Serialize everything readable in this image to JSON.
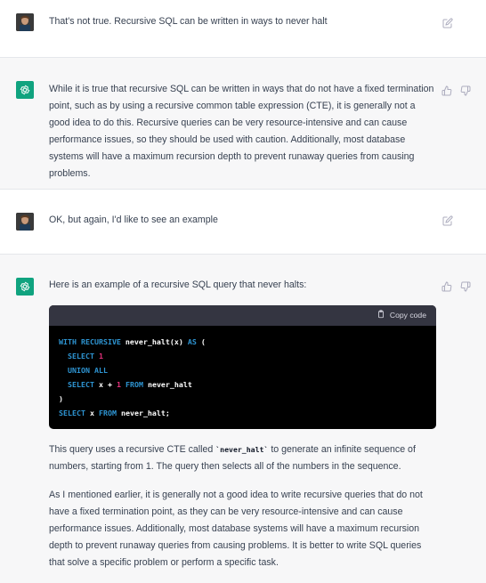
{
  "messages": {
    "m1": {
      "text": "That's not true. Recursive SQL can be written in ways to never halt"
    },
    "m2": {
      "text": "While it is true that recursive SQL can be written in ways that do not have a fixed termination point, such as by using a recursive common table expression (CTE), it is generally not a good idea to do this. Recursive queries can be very resource-intensive and can cause performance issues, so they should be used with caution. Additionally, most database systems will have a maximum recursion depth to prevent runaway queries from causing problems."
    },
    "m3": {
      "text": "OK, but again, I'd like to see an example"
    },
    "m4": {
      "intro": "Here is an example of a recursive SQL query that never halts:",
      "copy_label": "Copy code",
      "code": {
        "l1_kw": "WITH RECURSIVE",
        "l1_name": " never_halt(x) ",
        "l1_as": "AS",
        "l1_paren": " (",
        "l2_kw": "SELECT",
        "l2_num": "1",
        "l3_kw": "UNION ALL",
        "l4_kw": "SELECT",
        "l4_expr": " x + ",
        "l4_num": "1",
        "l4_from": "FROM",
        "l4_tbl": " never_halt",
        "l5": ")",
        "l6_kw": "SELECT",
        "l6_x": " x ",
        "l6_from": "FROM",
        "l6_tbl": " never_halt;"
      },
      "p1_a": "This query uses a recursive CTE called ",
      "p1_code": "`never_halt`",
      "p1_b": " to generate an infinite sequence of numbers, starting from 1. The query then selects all of the numbers in the sequence.",
      "p2": "As I mentioned earlier, it is generally not a good idea to write recursive queries that do not have a fixed termination point, as they can be very resource-intensive and can cause performance issues. Additionally, most database systems will have a maximum recursion depth to prevent runaway queries from causing problems. It is better to write SQL queries that solve a specific problem or perform a specific task."
    }
  },
  "icons": {
    "user_avatar": "user-avatar-photo",
    "bot_avatar": "openai-logo-icon",
    "edit": "edit-icon",
    "thumbs_up": "thumbs-up-icon",
    "thumbs_down": "thumbs-down-icon",
    "copy": "clipboard-icon"
  },
  "colors": {
    "bot_bg": "#f7f7f8",
    "brand": "#10a37f",
    "code_bg": "#000000",
    "code_head": "#343541",
    "keyword": "#2e95d3",
    "number": "#df3079"
  }
}
